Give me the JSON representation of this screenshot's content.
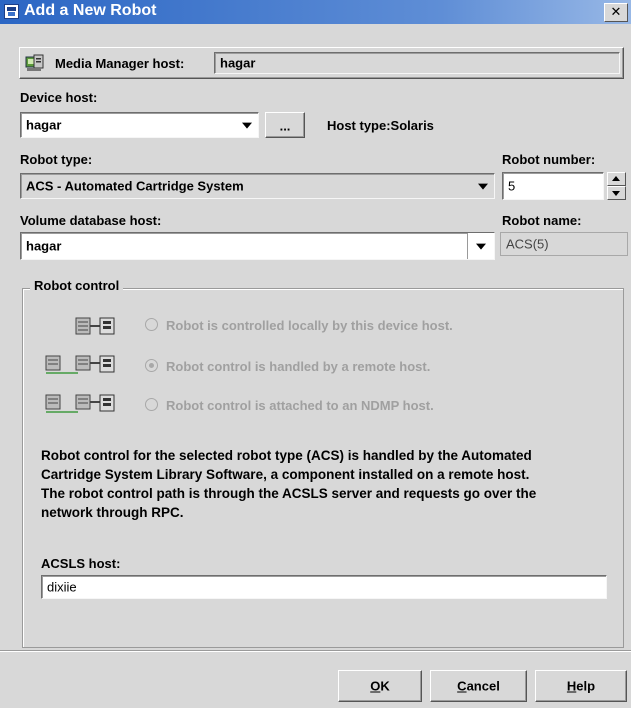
{
  "window": {
    "title": "Add a New Robot",
    "close_glyph": "✕"
  },
  "media_manager": {
    "label": "Media Manager host:",
    "value": "hagar",
    "icon": "server-host-icon"
  },
  "device_host": {
    "label": "Device host:",
    "value": "hagar",
    "browse_label": "...",
    "host_type_text": "Host type:Solaris"
  },
  "robot_type": {
    "label": "Robot type:",
    "value": "ACS - Automated Cartridge System"
  },
  "robot_number": {
    "label": "Robot number:",
    "value": "5"
  },
  "volume_db_host": {
    "label": "Volume database host:",
    "value": "hagar"
  },
  "robot_name": {
    "label": "Robot name:",
    "value": "ACS(5)"
  },
  "robot_control": {
    "group_label": "Robot control",
    "options": [
      {
        "label": "Robot is controlled locally by this device host.",
        "selected": false,
        "icon": "local-control-icon"
      },
      {
        "label": "Robot control is handled by a remote host.",
        "selected": true,
        "icon": "remote-control-icon"
      },
      {
        "label": "Robot control is attached to an NDMP host.",
        "selected": false,
        "icon": "ndmp-control-icon"
      }
    ],
    "description_lines": [
      "Robot control for the selected robot type (ACS) is handled by the Automated",
      "Cartridge System Library Software, a component installed on a remote host.",
      "The robot control path is through the ACSLS server and requests go over the",
      "network through RPC."
    ],
    "acsls_label": "ACSLS host:",
    "acsls_value": "dixiie"
  },
  "buttons": {
    "ok": {
      "mnemonic": "O",
      "rest": "K"
    },
    "cancel": {
      "mnemonic": "C",
      "rest": "ancel"
    },
    "help": {
      "mnemonic": "H",
      "rest": "elp"
    }
  },
  "colors": {
    "title_bar": "#2b66c4",
    "dialog_bg": "#d8d8d8",
    "disabled_text": "#a0a0a0"
  }
}
